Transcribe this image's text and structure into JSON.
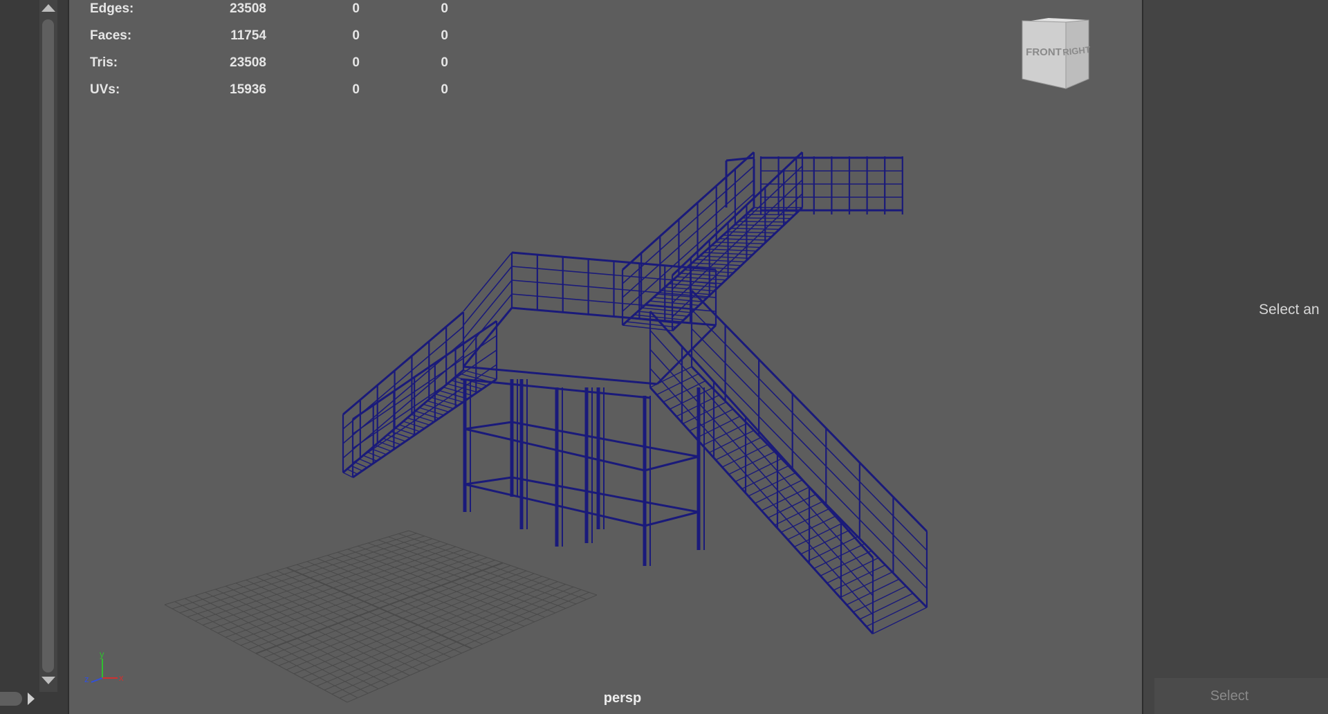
{
  "hud": {
    "rows": [
      {
        "label": "Edges:",
        "total": "23508",
        "selected": "0",
        "extra": "0"
      },
      {
        "label": "Faces:",
        "total": "11754",
        "selected": "0",
        "extra": "0"
      },
      {
        "label": "Tris:",
        "total": "23508",
        "selected": "0",
        "extra": "0"
      },
      {
        "label": "UVs:",
        "total": "15936",
        "selected": "0",
        "extra": "0"
      }
    ]
  },
  "viewcube": {
    "front_label": "FRONT",
    "right_label": "RIGHT"
  },
  "axis": {
    "x": "x",
    "y": "y",
    "z": "z"
  },
  "camera_label": "persp",
  "attribute_panel": {
    "prompt": "Select an",
    "select_button": "Select"
  },
  "colors": {
    "viewport_bg": "#5d5d5d",
    "wireframe": "#1a1a7a",
    "grid": "#4a4a4a",
    "panel_bg": "#444444",
    "axis_x": "#d03030",
    "axis_y": "#30c030",
    "axis_z": "#3050e0"
  },
  "icons": [
    "scroll-up-icon",
    "scroll-down-icon",
    "scroll-right-icon",
    "viewcube-icon",
    "axis-gizmo-icon"
  ]
}
